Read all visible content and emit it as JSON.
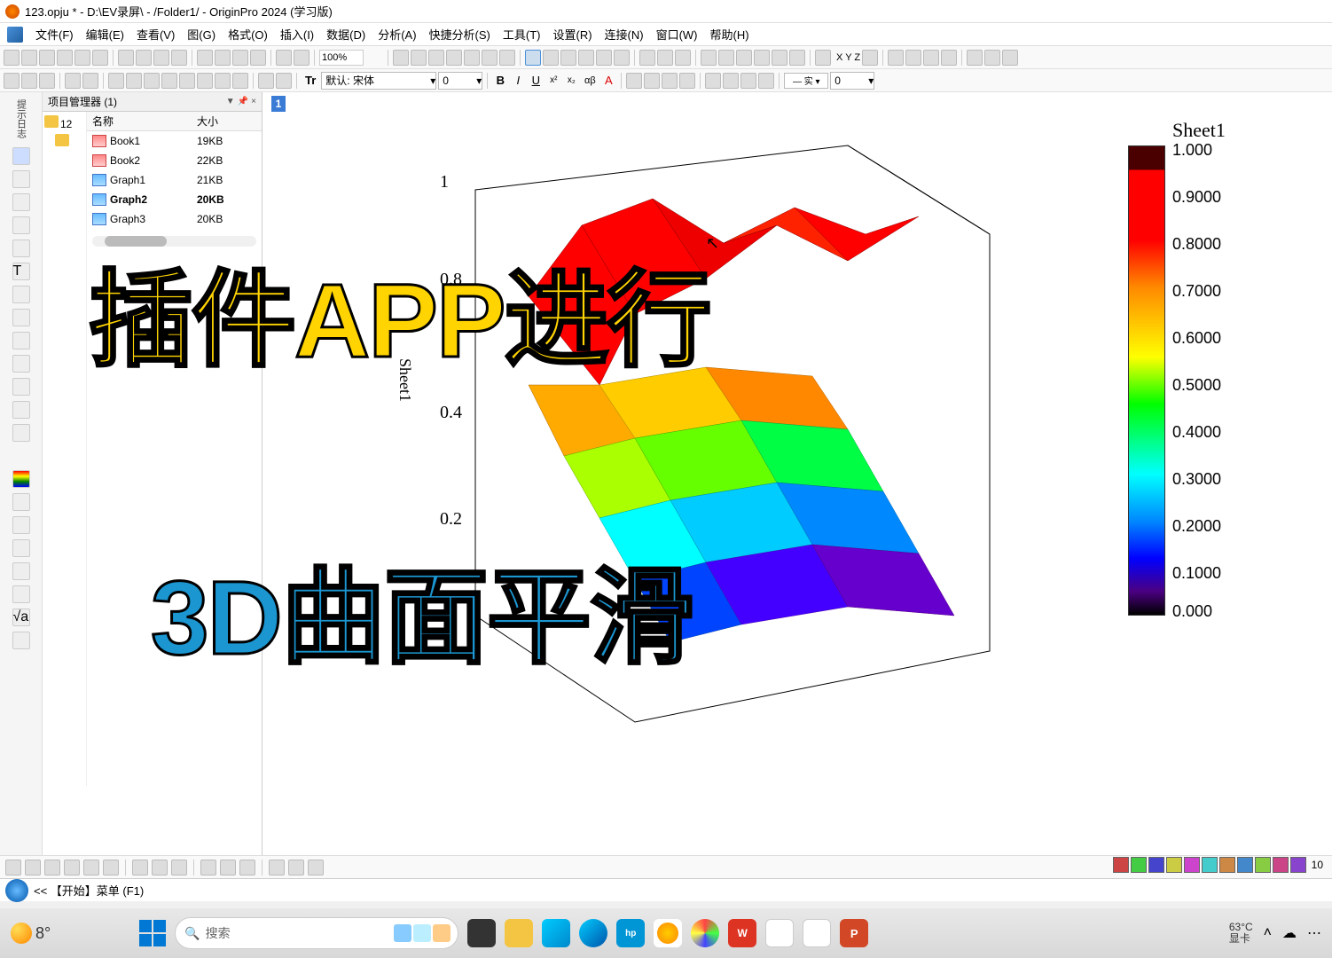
{
  "title": "123.opju * - D:\\EV录屏\\ - /Folder1/ - OriginPro 2024 (学习版)",
  "menu": [
    "文件(F)",
    "编辑(E)",
    "查看(V)",
    "图(G)",
    "格式(O)",
    "插入(I)",
    "数据(D)",
    "分析(A)",
    "快捷分析(S)",
    "工具(T)",
    "设置(R)",
    "连接(N)",
    "窗口(W)",
    "帮助(H)"
  ],
  "zoom": "100%",
  "font": {
    "prefix": "Tr",
    "name": "默认: 宋体",
    "size": "0"
  },
  "panel": {
    "title": "项目管理器 (1)",
    "folder": "12",
    "columns": [
      "名称",
      "大小"
    ],
    "items": [
      {
        "name": "Book1",
        "size": "19KB",
        "type": "book"
      },
      {
        "name": "Book2",
        "size": "22KB",
        "type": "book"
      },
      {
        "name": "Graph1",
        "size": "21KB",
        "type": "graph"
      },
      {
        "name": "Graph2",
        "size": "20KB",
        "type": "graph",
        "bold": true
      },
      {
        "name": "Graph3",
        "size": "20KB",
        "type": "graph"
      }
    ]
  },
  "window_marker": "1",
  "chart_data": {
    "type": "3d_surface",
    "title": "Sheet1",
    "z_axis_label": "Sheet1",
    "z_ticks": [
      0.2,
      0.4,
      0.8,
      1.0
    ],
    "zlim": [
      0,
      1.0
    ],
    "colorbar": {
      "min": 0.0,
      "max": 1.0,
      "ticks": [
        "1.000",
        "0.9000",
        "0.8000",
        "0.7000",
        "0.6000",
        "0.5000",
        "0.4000",
        "0.3000",
        "0.2000",
        "0.1000",
        "0.000"
      ]
    }
  },
  "overlay": {
    "line1": "插件APP进行",
    "line2": "3D曲面平滑"
  },
  "status": "<< 【开始】菜单 (F1)",
  "bottom_count": "10",
  "taskbar": {
    "weather_temp": "8°",
    "search_placeholder": "搜索",
    "gpu": {
      "temp": "63°C",
      "label": "显卡"
    }
  }
}
